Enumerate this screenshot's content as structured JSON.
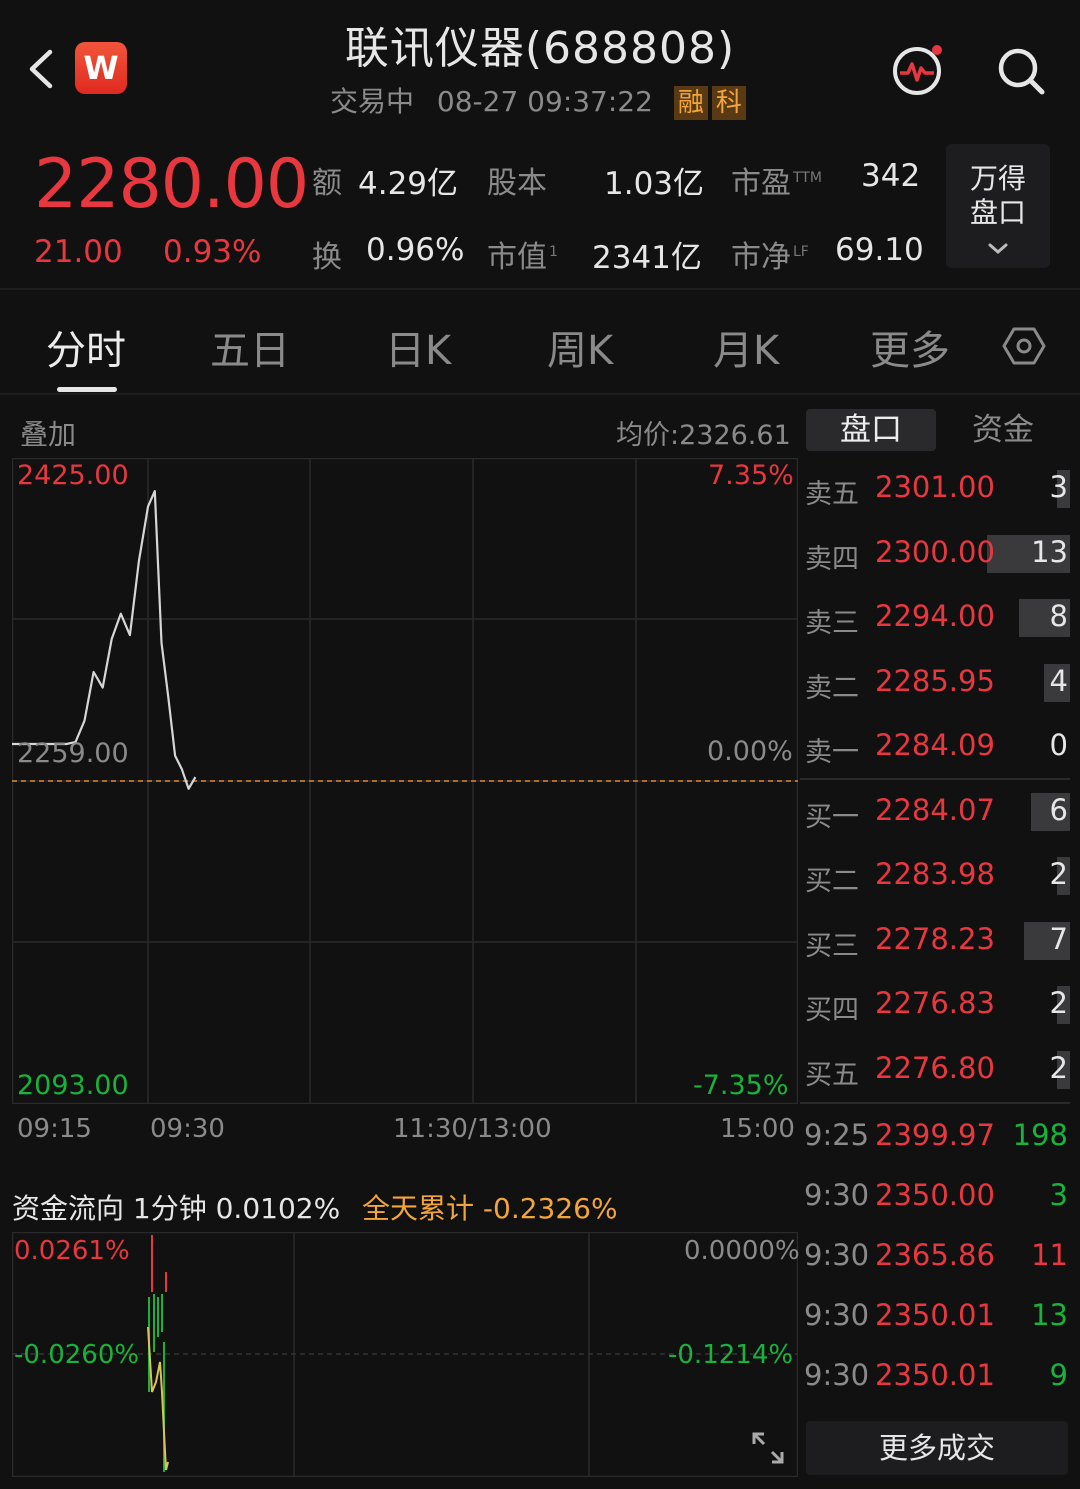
{
  "header": {
    "title": "联讯仪器(688808)",
    "status": "交易中",
    "datetime": "08-27 09:37:22",
    "tags": [
      "融",
      "科"
    ],
    "logo_letter": "W"
  },
  "quote": {
    "price": "2280.00",
    "change": "21.00",
    "change_pct": "0.93%",
    "stats": [
      {
        "label": "额",
        "sup": "",
        "value": "4.29亿"
      },
      {
        "label": "股本",
        "sup": "",
        "value": "1.03亿"
      },
      {
        "label": "市盈",
        "sup": "TTM",
        "value": "342"
      },
      {
        "label": "换",
        "sup": "",
        "value": "0.96%"
      },
      {
        "label": "市值",
        "sup": "1",
        "value": "2341亿"
      },
      {
        "label": "市净",
        "sup": "LF",
        "value": "69.10"
      }
    ],
    "wind_button": [
      "万得",
      "盘口"
    ]
  },
  "tabs": [
    "分时",
    "五日",
    "日K",
    "周K",
    "月K",
    "更多"
  ],
  "chart": {
    "overlay_label": "叠加",
    "avg_price": "均价:2326.61",
    "y_top": "2425.00",
    "y_mid": "2259.00",
    "y_bot": "2093.00",
    "pct_top": "7.35%",
    "pct_mid": "0.00%",
    "pct_bot": "-7.35%",
    "times": [
      "09:15",
      "09:30",
      "11:30/13:00",
      "15:00"
    ]
  },
  "chart_data": {
    "type": "line",
    "ylim": [
      2093.0,
      2425.0
    ],
    "reference": 2259.0,
    "x": [
      "09:15",
      "09:16",
      "09:17",
      "09:18",
      "09:19",
      "09:20",
      "09:21",
      "09:22",
      "09:23",
      "09:24",
      "09:25",
      "09:26",
      "09:27",
      "09:28",
      "09:29",
      "09:30",
      "09:31",
      "09:32",
      "09:33",
      "09:34",
      "09:35",
      "09:36",
      "09:37"
    ],
    "values": [
      2278,
      2278,
      2278,
      2278,
      2278,
      2278,
      2278,
      2279,
      2290,
      2315,
      2307,
      2332,
      2345,
      2334,
      2372,
      2400,
      2408,
      2330,
      2302,
      2272,
      2265,
      2255,
      2261
    ]
  },
  "panel_tabs": [
    "盘口",
    "资金"
  ],
  "order_book": {
    "asks": [
      {
        "label": "卖五",
        "price": "2301.00",
        "vol": "3",
        "bar": 0.15
      },
      {
        "label": "卖四",
        "price": "2300.00",
        "vol": "13",
        "bar": 0.98
      },
      {
        "label": "卖三",
        "price": "2294.00",
        "vol": "8",
        "bar": 0.6
      },
      {
        "label": "卖二",
        "price": "2285.95",
        "vol": "4",
        "bar": 0.3
      },
      {
        "label": "卖一",
        "price": "2284.09",
        "vol": "0",
        "bar": 0
      }
    ],
    "bids": [
      {
        "label": "买一",
        "price": "2284.07",
        "vol": "6",
        "bar": 0.46
      },
      {
        "label": "买二",
        "price": "2283.98",
        "vol": "2",
        "bar": 0.15
      },
      {
        "label": "买三",
        "price": "2278.23",
        "vol": "7",
        "bar": 0.54
      },
      {
        "label": "买四",
        "price": "2276.83",
        "vol": "2",
        "bar": 0.15
      },
      {
        "label": "买五",
        "price": "2276.80",
        "vol": "2",
        "bar": 0.15
      }
    ]
  },
  "ticks": [
    {
      "time": "9:25",
      "price": "2399.97",
      "vol": "198",
      "color": "#19b23a"
    },
    {
      "time": "9:30",
      "price": "2350.00",
      "vol": "3",
      "color": "#19b23a"
    },
    {
      "time": "9:30",
      "price": "2365.86",
      "vol": "11",
      "color": "#e8373e"
    },
    {
      "time": "9:30",
      "price": "2350.01",
      "vol": "13",
      "color": "#19b23a"
    },
    {
      "time": "9:30",
      "price": "2350.01",
      "vol": "9",
      "color": "#19b23a"
    }
  ],
  "more_trades": "更多成交",
  "flow": {
    "title": "资金流向 1分钟 0.0102%",
    "total": "全天累计 -0.2326%",
    "left_top": "0.0261%",
    "left_mid": "-0.0260%",
    "right_top": "0.0000%",
    "right_mid": "-0.1214%"
  },
  "colors": {
    "up": "#e8373e",
    "down": "#19b23a",
    "accent": "#f2a53a"
  }
}
